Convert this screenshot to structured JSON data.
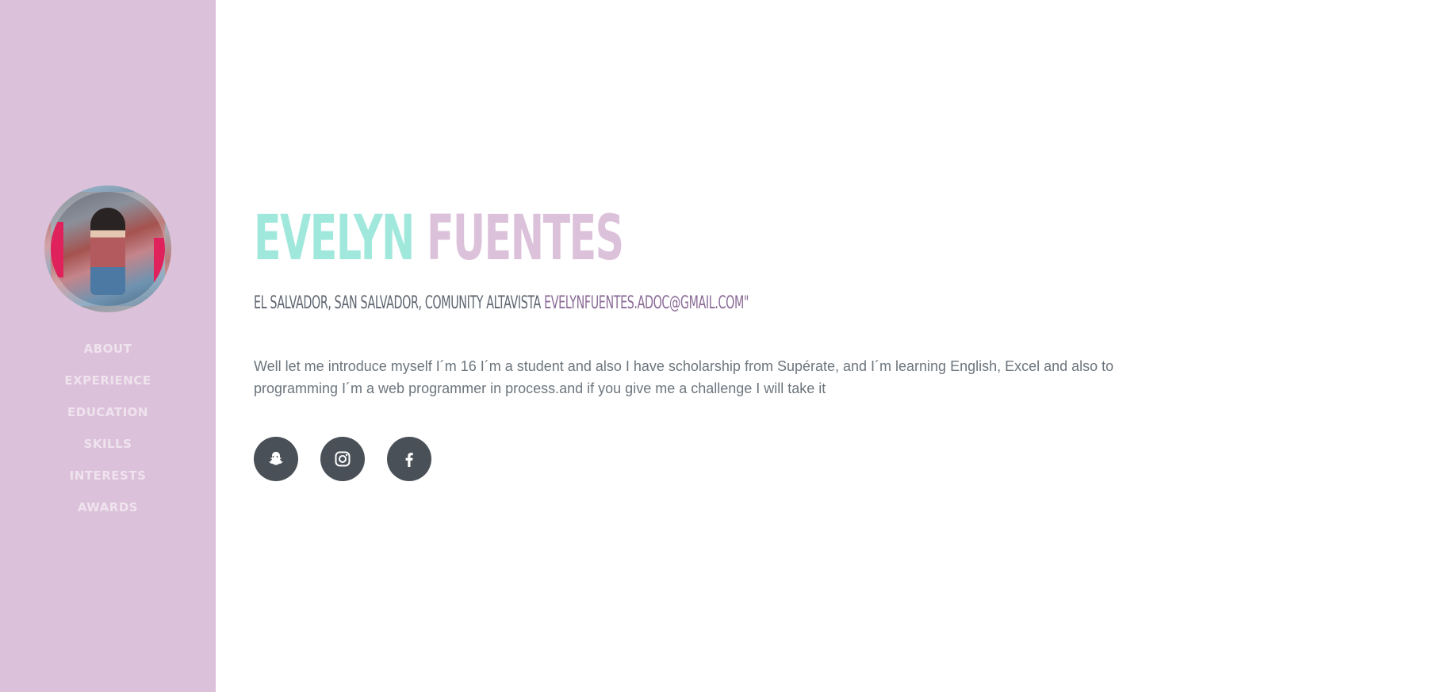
{
  "sidebar": {
    "background": "#dcc1da",
    "nav": [
      "About",
      "Experience",
      "Education",
      "Skills",
      "Interests",
      "Awards"
    ]
  },
  "header": {
    "first_name": "Evelyn",
    "last_name": "Fuentes",
    "address": "El Salvador, San Salvador, Comunity Altavista",
    "email": "evelynfuentes.adoc@gmail.com\""
  },
  "bio": "Well let me introduce myself I´m 16 I´m a student and also I have scholarship from Supérate, and I´m learning English, Excel and also to programming I´m a web programmer in process.and if you give me a challenge I will take it",
  "social": [
    {
      "icon": "snapchat-icon"
    },
    {
      "icon": "instagram-icon"
    },
    {
      "icon": "facebook-icon"
    }
  ],
  "colors": {
    "accent_primary": "#a1e8dc",
    "accent_secondary": "#dcc1da",
    "social_bg": "#495057",
    "text": "#6c757d"
  }
}
